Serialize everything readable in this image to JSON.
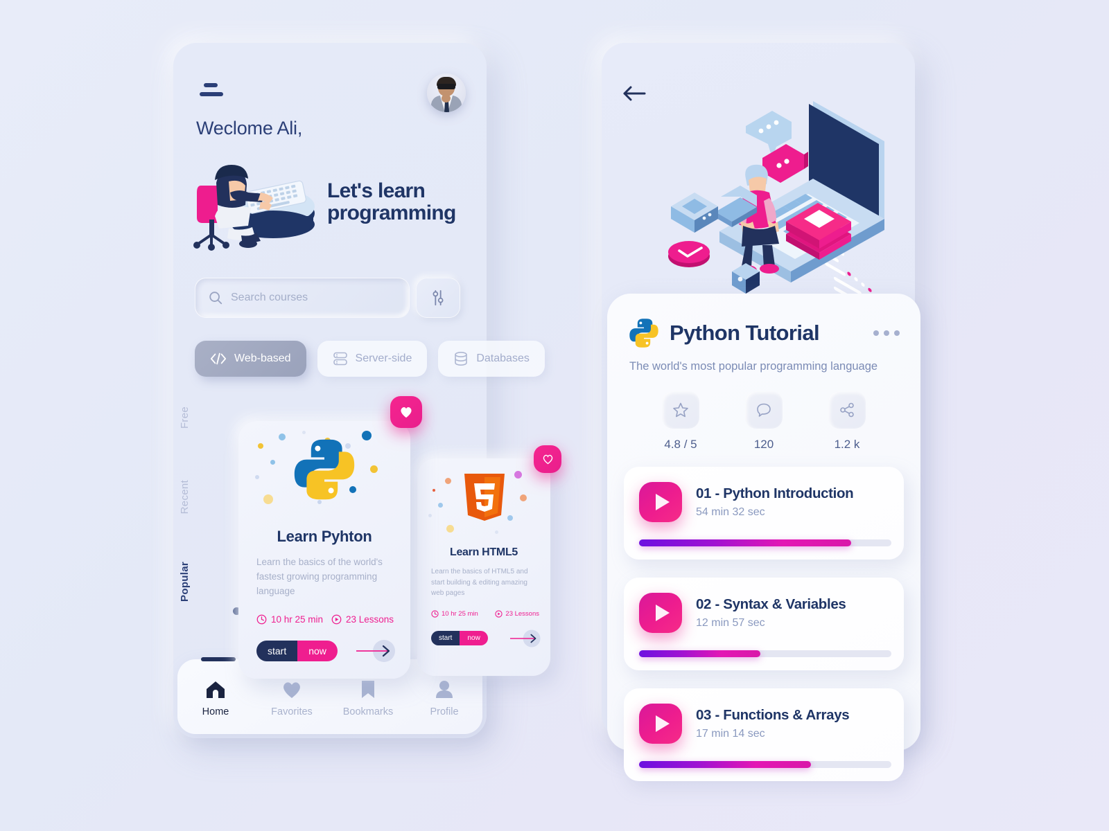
{
  "theme": {
    "accent_pink": "#ef1e8f",
    "accent_navy": "#1f3566",
    "bg": "#e6eaf8",
    "muted": "#a7b0c9"
  },
  "left_screen": {
    "menu_icon": "hamburger-menu-icon",
    "avatar": "user-avatar",
    "welcome": "Weclome Ali,",
    "hero_title": "Let's learn programming",
    "hero_illustration": "person-at-desk-illustration",
    "search": {
      "placeholder": "Search courses",
      "value": "",
      "icon": "search-icon",
      "filter_icon": "sliders-filter-icon"
    },
    "categories": [
      {
        "label": "Web-based",
        "icon": "code-brackets-icon",
        "active": true
      },
      {
        "label": "Server-side",
        "icon": "server-icon",
        "active": false
      },
      {
        "label": "Databases",
        "icon": "database-icon",
        "active": false
      }
    ],
    "sort_rail": [
      {
        "label": "Free",
        "active": false
      },
      {
        "label": "Recent",
        "active": false
      },
      {
        "label": "Popular",
        "active": true
      }
    ],
    "courses": [
      {
        "title": "Learn Pyhton",
        "logo": "python-logo",
        "description": "Learn the basics of  the world's fastest  growing  programming language",
        "duration": "10 hr 25 min",
        "lessons": "23 Lessons",
        "start_label": "start",
        "now_label": "now",
        "favorite": true,
        "favorite_icon": "heart-filled-icon"
      },
      {
        "title": "Learn HTML5",
        "logo": "html5-logo",
        "description": "Learn  the  basics of  HTML5 and start building & editing amazing web pages",
        "duration": "10 hr 25 min",
        "lessons": "23 Lessons",
        "start_label": "start",
        "now_label": "now",
        "favorite": false,
        "favorite_icon": "heart-outline-icon"
      }
    ],
    "bottom_nav": [
      {
        "label": "Home",
        "icon": "home-icon",
        "active": true
      },
      {
        "label": "Favorites",
        "icon": "heart-icon",
        "active": false
      },
      {
        "label": "Bookmarks",
        "icon": "bookmark-icon",
        "active": false
      },
      {
        "label": "Profile",
        "icon": "person-icon",
        "active": false
      }
    ]
  },
  "right_screen": {
    "back_icon": "arrow-left-icon",
    "illustration": "person-on-laptop-isometric-illustration",
    "title": "Python Tutorial",
    "title_logo": "python-logo",
    "more_icon": "more-horizontal-icon",
    "subtitle": "The world's most popular programming language",
    "stats": [
      {
        "icon": "star-icon",
        "value": "4.8 / 5"
      },
      {
        "icon": "comment-icon",
        "value": "120"
      },
      {
        "icon": "share-icon",
        "value": "1.2 k"
      }
    ],
    "lessons": [
      {
        "name": "01 - Python Introduction",
        "duration": "54 min 32 sec",
        "progress": 84,
        "play_icon": "play-icon"
      },
      {
        "name": "02 - Syntax & Variables",
        "duration": "12 min 57 sec",
        "progress": 48,
        "play_icon": "play-icon"
      },
      {
        "name": "03 - Functions & Arrays",
        "duration": "17 min 14 sec",
        "progress": 68,
        "play_icon": "play-icon"
      }
    ]
  }
}
